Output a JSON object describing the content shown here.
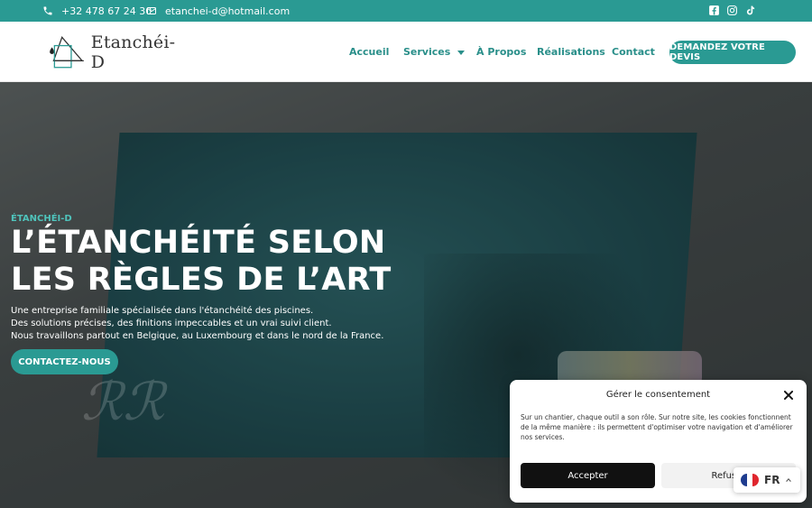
{
  "topbar": {
    "phone": "+32 478 67 24 30",
    "email": "etanchei-d@hotmail.com",
    "icons": [
      "phone-icon",
      "mail-icon",
      "facebook-icon",
      "instagram-icon",
      "tiktok-icon"
    ]
  },
  "header": {
    "logo_text": "Etanchéi-D",
    "nav": {
      "home": "Accueil",
      "services": "Services",
      "about": "À Propos",
      "projects": "Réalisations",
      "contact": "Contact"
    },
    "cta": "DEMANDEZ VOTRE DEVIS"
  },
  "hero": {
    "eyebrow": "ÉTANCHÉI-D",
    "title_line1": "L’ÉTANCHÉITÉ SELON",
    "title_line2": "LES RÈGLES DE L’ART",
    "desc_line1": "Une entreprise familiale spécialisée dans l'étanchéité des piscines.",
    "desc_line2": "Des solutions précises, des finitions impeccables et un vrai suivi client.",
    "desc_line3": "Nous travaillons partout en Belgique, au Luxembourg et dans le nord de la France.",
    "button": "CONTACTEZ-NOUS"
  },
  "consent": {
    "title": "Gérer le consentement",
    "text": "Sur un chantier, chaque outil a son rôle. Sur notre site, les cookies fonctionnent de la même manière : ils permettent d'optimiser votre navigation et d'améliorer nos services.",
    "accept": "Accepter",
    "refuse": "Refuser"
  },
  "language": {
    "code": "FR"
  },
  "colors": {
    "accent": "#2a9a93",
    "nav_text": "#2a8f8a",
    "dark_button": "#111111"
  }
}
